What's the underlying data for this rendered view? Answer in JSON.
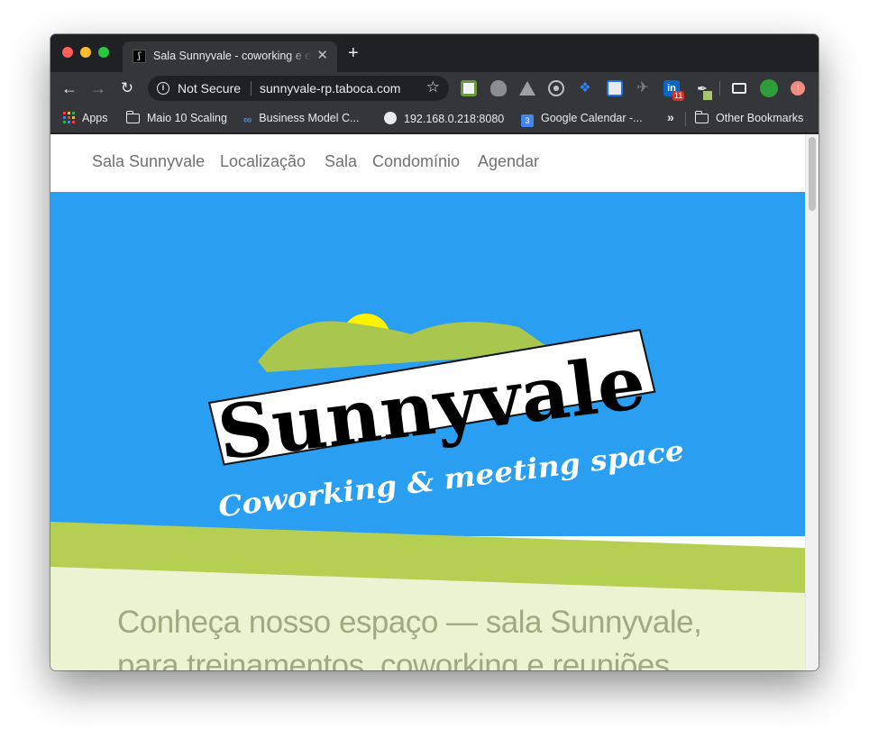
{
  "browser": {
    "tab_title": "Sala Sunnyvale - coworking e esp",
    "tab_close": "✕",
    "new_tab": "+",
    "security_label": "Not Secure",
    "url": "sunnyvale-rp.taboca.com",
    "linkedin_badge": "11"
  },
  "bookmarks": [
    {
      "label": "Apps",
      "icon": "apps-grid-icon"
    },
    {
      "label": "Maio 10 Scaling",
      "icon": "folder-icon"
    },
    {
      "label": "Business Model C...",
      "icon": "link-icon"
    },
    {
      "label": "192.168.0.218:8080",
      "icon": "globe-icon"
    },
    {
      "label": "Google Calendar -...",
      "icon": "calendar-icon"
    },
    {
      "label": "Other Bookmarks",
      "icon": "folder-icon"
    }
  ],
  "bookmarks_more": "»",
  "site": {
    "nav": [
      "Sala Sunnyvale",
      "Localização",
      "Sala",
      "Condomínio",
      "Agendar"
    ],
    "logo_title": "Sunnyvale",
    "logo_subtitle": "Coworking & meeting space",
    "headline_line1": "Conheça nosso espaço — sala Sunnyvale,",
    "headline_line2": "para treinamentos, coworking e reuniões"
  },
  "colors": {
    "hero_blue": "#2a9ef0",
    "hill_green": "#b4cf52",
    "sun_yellow": "#fff200",
    "pale_green": "#ecf3d2",
    "headline_text": "#a0aa82"
  }
}
